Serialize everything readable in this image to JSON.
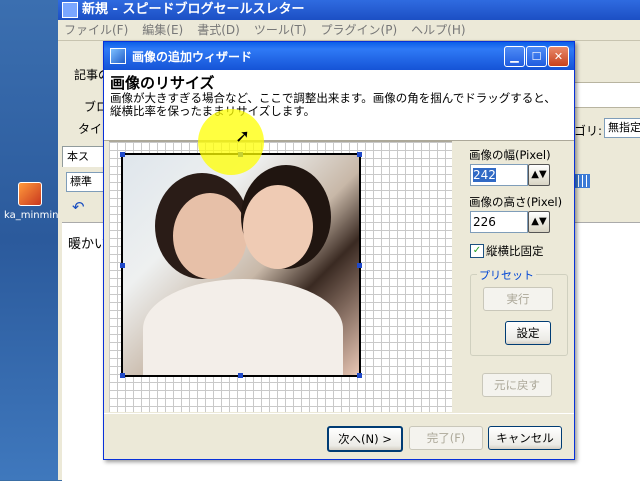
{
  "desktop": {
    "icon_label": "ka_minmin"
  },
  "app": {
    "title": "新規 - スピードブログセールスレター",
    "menu": [
      "ファイル(F)",
      "編集(E)",
      "書式(D)",
      "ツール(T)",
      "プラグイン(P)",
      "ヘルプ(H)"
    ],
    "label_article": "記事の",
    "label_blog": "ブロ",
    "label_title": "タイト",
    "label_category": "ゴリ:",
    "category_value": "無指定",
    "tab_label": "本ス",
    "style_value": "標準",
    "editor_text": "暖かい"
  },
  "dialog": {
    "title": "画像の追加ウィザード",
    "heading": "画像のリサイズ",
    "description": "画像が大きすぎる場合など、ここで調整出来ます。画像の角を掴んでドラッグすると、縦横比率を保ったままリサイズします。",
    "width_label": "画像の幅(Pixel)",
    "width_value": "242",
    "height_label": "画像の高さ(Pixel)",
    "height_value": "226",
    "keep_ratio_label": "縦横比固定",
    "keep_ratio_checked": true,
    "preset_label": "プリセット",
    "execute_label": "実行",
    "settings_label": "設定",
    "reset_label": "元に戻す",
    "next_label": "次へ(N) >",
    "finish_label": "完了(F)",
    "cancel_label": "キャンセル"
  },
  "colors": {
    "titlebar": "#1553d6",
    "close": "#c7411c",
    "highlight": "#ffff00",
    "dialog_bg": "#ece9d8"
  }
}
